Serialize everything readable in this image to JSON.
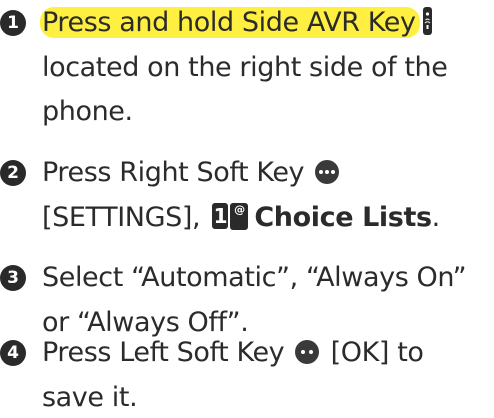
{
  "steps": [
    {
      "number": "1",
      "highlight": "Press and hold Side AVR Key",
      "icon": "side-avr-key-icon",
      "lines": [
        "located on the right side of the",
        "phone."
      ]
    },
    {
      "number": "2",
      "line1": "Press Right Soft Key",
      "icon": "right-soft-key-icon",
      "line2_prefix": "[SETTINGS],",
      "key_label": "1",
      "key_sub": "@",
      "line2_bold": "Choice Lists",
      "line2_suffix": "."
    },
    {
      "number": "3",
      "lines": [
        "Select “Automatic”, “Always On”",
        "or “Always Off”."
      ]
    },
    {
      "number": "4",
      "line1_prefix": "Press Left Soft Key",
      "icon": "left-soft-key-icon",
      "line1_suffix": "[OK] to",
      "line2": "save it."
    }
  ],
  "colors": {
    "highlight": "#ffef40",
    "text": "#2b2b2b",
    "badge": "#2a2a2a"
  }
}
